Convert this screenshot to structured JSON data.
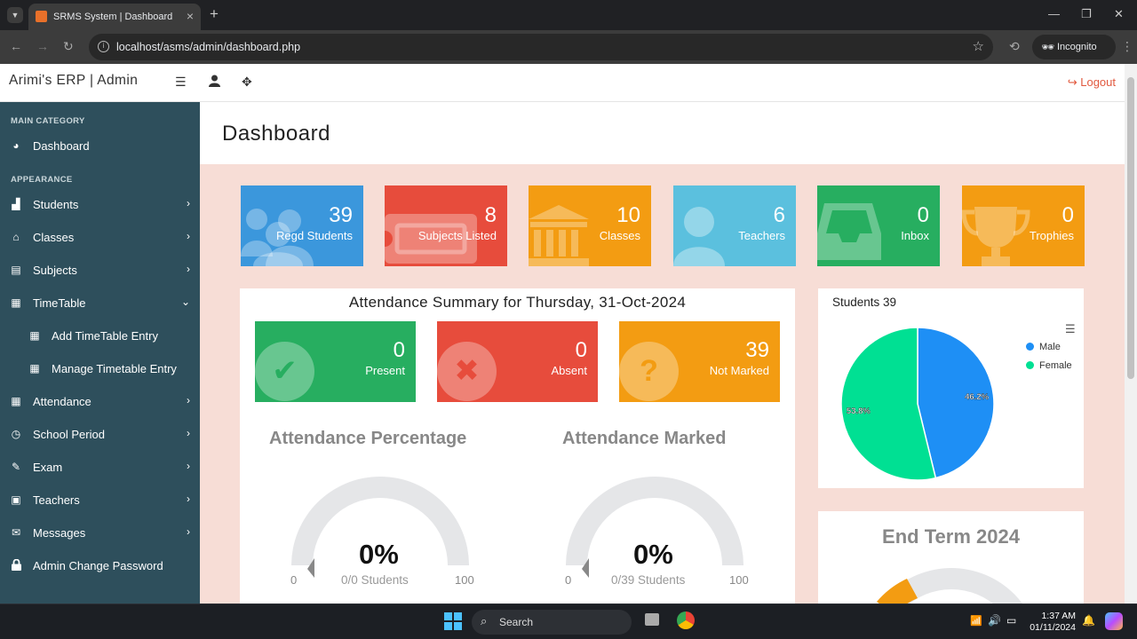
{
  "browser": {
    "tab_title": "SRMS System | Dashboard",
    "url": "localhost/asms/admin/dashboard.php",
    "incognito_label": "Incognito"
  },
  "topnav": {
    "brand": "Arimi's ERP | Admin",
    "logout": "Logout"
  },
  "sidebar": {
    "heading_main": "MAIN CATEGORY",
    "heading_appearance": "APPEARANCE",
    "items": [
      {
        "label": "Dashboard"
      },
      {
        "label": "Students"
      },
      {
        "label": "Classes"
      },
      {
        "label": "Subjects"
      },
      {
        "label": "TimeTable"
      },
      {
        "label": "Add TimeTable Entry"
      },
      {
        "label": "Manage Timetable Entry"
      },
      {
        "label": "Attendance"
      },
      {
        "label": "School Period"
      },
      {
        "label": "Exam"
      },
      {
        "label": "Teachers"
      },
      {
        "label": "Messages"
      },
      {
        "label": "Admin Change Password"
      }
    ]
  },
  "page": {
    "title": "Dashboard"
  },
  "stats": [
    {
      "value": "39",
      "label": "Regd Students",
      "color": "#3b97dc"
    },
    {
      "value": "8",
      "label": "Subjects Listed",
      "color": "#e74c3c"
    },
    {
      "value": "10",
      "label": "Classes",
      "color": "#f39c12"
    },
    {
      "value": "6",
      "label": "Teachers",
      "color": "#5bc0de"
    },
    {
      "value": "0",
      "label": "Inbox",
      "color": "#27ae60"
    },
    {
      "value": "0",
      "label": "Trophies",
      "color": "#f39c12"
    }
  ],
  "attendance": {
    "title": "Attendance Summary for Thursday, 31-Oct-2024",
    "present": {
      "value": "0",
      "label": "Present"
    },
    "absent": {
      "value": "0",
      "label": "Absent"
    },
    "not_marked": {
      "value": "39",
      "label": "Not Marked"
    },
    "gauge_percentage": {
      "title": "Attendance Percentage",
      "value": "0%",
      "sub": "0/0 Students",
      "min": "0",
      "max": "100"
    },
    "gauge_marked": {
      "title": "Attendance Marked",
      "value": "0%",
      "sub": "0/39 Students",
      "min": "0",
      "max": "100"
    }
  },
  "chart_data": {
    "type": "pie",
    "title": "Students 39",
    "series": [
      {
        "name": "Male",
        "value": 46.2,
        "label": "46.2%",
        "color": "#1e8ff5"
      },
      {
        "name": "Female",
        "value": 53.8,
        "label": "53.8%",
        "color": "#00e093"
      }
    ],
    "legend": "right"
  },
  "end_term": {
    "title": "End Term 2024"
  },
  "taskbar": {
    "search": "Search",
    "time": "1:37 AM",
    "date": "01/11/2024"
  }
}
